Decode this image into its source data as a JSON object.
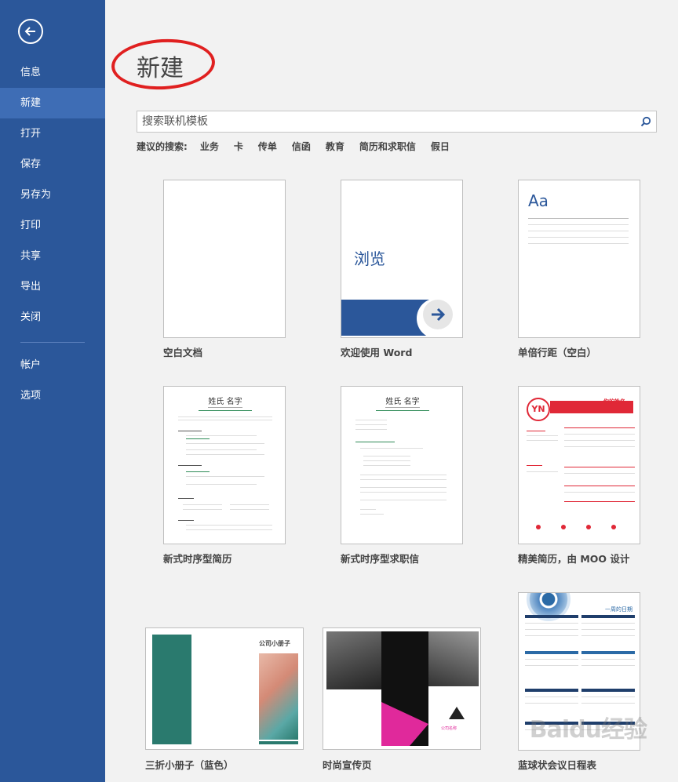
{
  "sidebar": {
    "items": [
      {
        "label": "信息"
      },
      {
        "label": "新建"
      },
      {
        "label": "打开"
      },
      {
        "label": "保存"
      },
      {
        "label": "另存为"
      },
      {
        "label": "打印"
      },
      {
        "label": "共享"
      },
      {
        "label": "导出"
      },
      {
        "label": "关闭"
      },
      {
        "label": "帐户"
      },
      {
        "label": "选项"
      }
    ]
  },
  "page": {
    "title": "新建"
  },
  "search": {
    "placeholder": "搜索联机模板",
    "value": ""
  },
  "suggested": {
    "label": "建议的搜索:",
    "tags": [
      "业务",
      "卡",
      "传单",
      "信函",
      "教育",
      "简历和求职信",
      "假日"
    ]
  },
  "templates": [
    {
      "label": "空白文档"
    },
    {
      "label": "欢迎使用 Word",
      "thumb_text": "浏览"
    },
    {
      "label": "单倍行距（空白）",
      "thumb_text": "Aa"
    },
    {
      "label": "新式时序型简历",
      "thumb_text": "姓氏 名字"
    },
    {
      "label": "新式时序型求职信",
      "thumb_text": "姓氏 名字"
    },
    {
      "label": "精美简历，由 MOO 设计",
      "thumb_text": "YN",
      "thumb_text2": "你的姓名"
    },
    {
      "label": "三折小册子（蓝色）",
      "thumb_text": "公司小册子"
    },
    {
      "label": "时尚宣传页",
      "thumb_text": "公司名称"
    },
    {
      "label": "蓝球状会议日程表",
      "thumb_text": "一周的日期"
    }
  ],
  "watermark": "Baidu经验",
  "colors": {
    "sidebar": "#2b579a",
    "sidebar_active": "#3e6db5",
    "accent_blue": "#2b579a",
    "annotation_red": "#e02020"
  }
}
